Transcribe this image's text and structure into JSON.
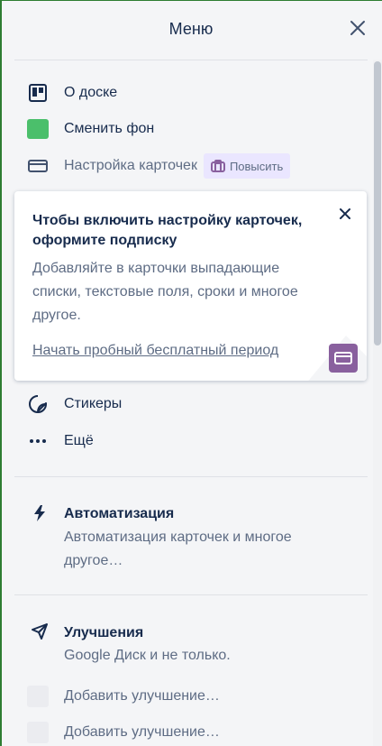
{
  "header": {
    "title": "Меню"
  },
  "menu": {
    "about": "О доске",
    "change_bg": "Сменить фон",
    "card_settings": "Настройка карточек",
    "upgrade_badge": "Повысить",
    "stickers": "Стикеры",
    "more": "Ещё"
  },
  "popup": {
    "title": "Чтобы включить настройку карточек, оформите подписку",
    "body": "Добавляйте в карточки выпадающие списки, текстовые поля, сроки и многое другое.",
    "link": "Начать пробный бесплатный период"
  },
  "automation": {
    "title": "Автоматизация",
    "desc": "Автоматизация карточек и многое другое…"
  },
  "powerups": {
    "title": "Улучшения",
    "desc": "Google Диск и не только.",
    "add_items": [
      "Добавить улучшение…",
      "Добавить улучшение…"
    ]
  },
  "colors": {
    "accent_green": "#4bbf6b",
    "upgrade_purple": "#89609e"
  },
  "icons": [
    "close-icon",
    "board-icon",
    "card-icon",
    "upgrade-icon",
    "sticker-icon",
    "more-icon",
    "lightning-icon",
    "rocket-icon"
  ]
}
